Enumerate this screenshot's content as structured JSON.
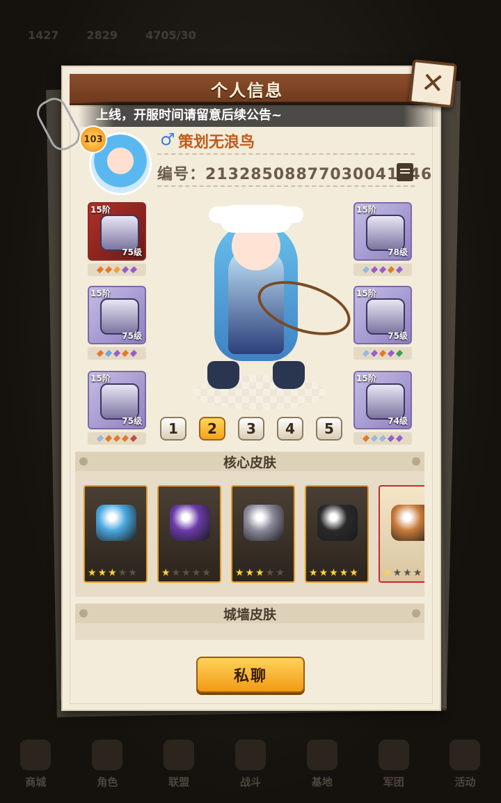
{
  "background": {
    "top_values": [
      "1427",
      "2829",
      "4705/30"
    ],
    "bottom_nav": [
      "商城",
      "角色",
      "联盟",
      "战斗",
      "基地",
      "军团",
      "活动"
    ]
  },
  "dialog": {
    "title": "个人信息",
    "notice": "上线，开服时间请留意后续公告~",
    "player": {
      "level": "103",
      "gender_symbol": "♂",
      "name": "策划无浪鸟",
      "id_label": "编号：",
      "id_value": "21328508877030041446"
    },
    "equipment_left": [
      {
        "rank": "15阶",
        "level": "75级",
        "frame": "red",
        "gems": [
          "#e07a2c",
          "#e07a2c",
          "#f0a040",
          "#9a5cc8",
          "#9a5cc8"
        ]
      },
      {
        "rank": "15阶",
        "level": "75级",
        "frame": "purple",
        "gems": [
          "#e07a2c",
          "#6aa8e0",
          "#9a5cc8",
          "#e07a2c",
          "#9a5cc8"
        ]
      },
      {
        "rank": "15阶",
        "level": "75级",
        "frame": "purple",
        "gems": [
          "#9ab8e0",
          "#e07a2c",
          "#e07a2c",
          "#e07a2c",
          "#c84a3a"
        ]
      }
    ],
    "equipment_right": [
      {
        "rank": "15阶",
        "level": "78级",
        "frame": "purple",
        "gems": [
          "#9ab8e0",
          "#9a5cc8",
          "#9a5cc8",
          "#e07a2c",
          "#9a5cc8"
        ]
      },
      {
        "rank": "15阶",
        "level": "75级",
        "frame": "purple",
        "gems": [
          "#9ab8e0",
          "#9a5cc8",
          "#e07a2c",
          "#9a5cc8",
          "#3aa050"
        ]
      },
      {
        "rank": "15阶",
        "level": "74级",
        "frame": "purple",
        "gems": [
          "#e07a2c",
          "#9ab8e0",
          "#9ab8e0",
          "#9a5cc8",
          "#9a5cc8"
        ]
      }
    ],
    "presets": [
      "1",
      "2",
      "3",
      "4",
      "5"
    ],
    "active_preset": "2",
    "core_skin_title": "核心皮肤",
    "skins": [
      {
        "stars": 3,
        "color": "#4aa8e0",
        "frame": "gold"
      },
      {
        "stars": 1,
        "color": "#6a3aa8",
        "frame": "gold"
      },
      {
        "stars": 3,
        "color": "#8a8a9a",
        "frame": "gold"
      },
      {
        "stars": 5,
        "color": "#2a2a2a",
        "frame": "gold"
      },
      {
        "stars": 1,
        "color": "#c87a3a",
        "frame": "red"
      }
    ],
    "wall_skin_title": "城墙皮肤",
    "chat_button": "私聊"
  }
}
